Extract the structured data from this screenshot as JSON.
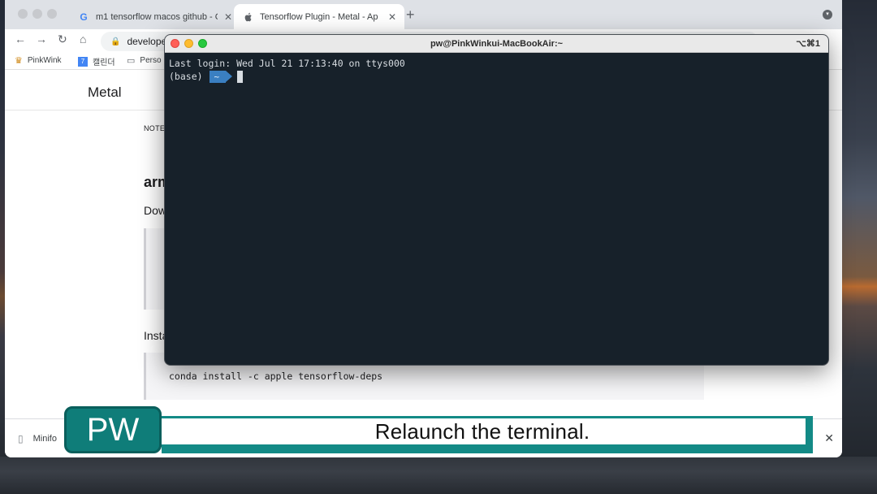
{
  "browser": {
    "tabs": [
      {
        "title": "m1 tensorflow macos github - G",
        "icon": "google-icon"
      },
      {
        "title": "Tensorflow Plugin - Metal - Ap",
        "icon": "apple-icon"
      }
    ],
    "address": "develope",
    "bookmarks": [
      {
        "label": "PinkWink",
        "icon": "crown-icon"
      },
      {
        "label": "캘린더",
        "icon": "calendar-icon"
      },
      {
        "label": "Perso",
        "icon": "folder-icon"
      }
    ]
  },
  "page": {
    "site_title": "Metal",
    "note": "NOTE",
    "heading": "arm",
    "para1": "Dow",
    "para2": "Insta",
    "code2": "conda install -c apple tensorflow-deps"
  },
  "download": {
    "file": "Minifo"
  },
  "terminal": {
    "title": "pw@PinkWinkui-MacBookAir:~",
    "shortcut": "⌥⌘1",
    "last_login": "Last login: Wed Jul 21 17:13:40 on ttys000",
    "env": "(base)",
    "dir": "~"
  },
  "subtitle": {
    "badge": "PW",
    "text": "Relaunch the terminal."
  },
  "colors": {
    "terminal_bg": "#17212a",
    "prompt_accent": "#3a7fc1",
    "subtitle_teal": "#138a86"
  }
}
